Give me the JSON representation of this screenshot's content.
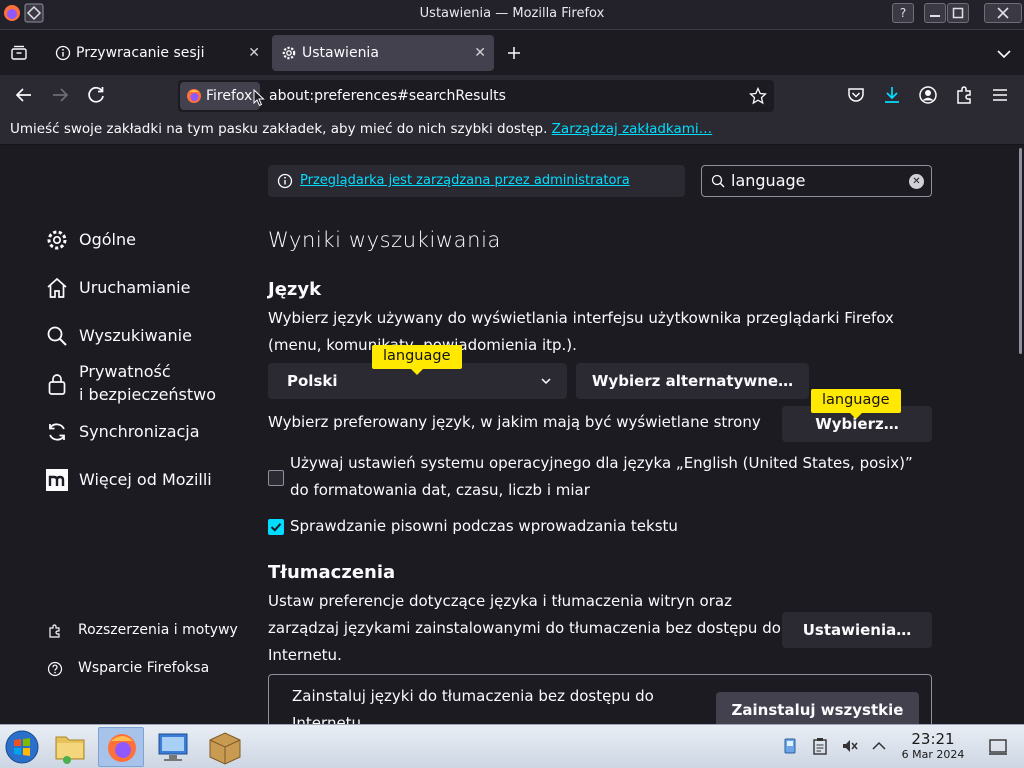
{
  "window": {
    "title": "Ustawienia — Mozilla Firefox",
    "help_button": "?"
  },
  "tabs": [
    {
      "label": "Przywracanie sesji"
    },
    {
      "label": "Ustawienia"
    }
  ],
  "navbar": {
    "identity_label": "Firefox",
    "url": "about:preferences#searchResults"
  },
  "bookmarks_bar": {
    "message": "Umieść swoje zakładki na tym pasku zakładek, aby mieć do nich szybki dostęp.",
    "manage_link": "Zarządzaj zakładkami…"
  },
  "sidebar": {
    "categories": [
      {
        "label": "Ogólne",
        "icon": "gear-icon"
      },
      {
        "label": "Uruchamianie",
        "icon": "home-icon"
      },
      {
        "label": "Wyszukiwanie",
        "icon": "search-icon"
      },
      {
        "label": "Prywatność\ni bezpieczeństwo",
        "icon": "lock-icon"
      },
      {
        "label": "Synchronizacja",
        "icon": "sync-icon"
      },
      {
        "label": "Więcej od Mozilli",
        "icon": "mozilla-icon"
      }
    ],
    "footer": [
      {
        "label": "Rozszerzenia i motywy",
        "icon": "puzzle-icon"
      },
      {
        "label": "Wsparcie Firefoksa",
        "icon": "help-icon"
      }
    ]
  },
  "policy_notice": "Przeglądarka jest zarządzana przez administratora",
  "search": {
    "value": "language"
  },
  "results_heading": "Wyniki wyszukiwania",
  "language_section": {
    "heading": "Język",
    "description": "Wybierz język używany do wyświetlania interfejsu użytkownika przeglądarki Firefox (menu, komunikaty, powiadomienia itp.).",
    "selected_language": "Polski",
    "alternatives_button": "Wybierz alternatywne…",
    "preferred_label": "Wybierz preferowany język, w jakim mają być wyświetlane strony",
    "choose_button": "Wybierz…",
    "tooltip": "language",
    "os_checkbox_label": "Używaj ustawień systemu operacyjnego dla języka „English (United States, posix)” do formatowania dat, czasu, liczb i miar",
    "os_checkbox_checked": false,
    "spellcheck_label": "Sprawdzanie pisowni podczas wprowadzania tekstu",
    "spellcheck_checked": true
  },
  "translations_section": {
    "heading": "Tłumaczenia",
    "description": "Ustaw preferencje dotyczące języka i tłumaczenia witryn oraz zarządzaj językami zainstalowanymi do tłumaczenia bez dostępu do Internetu.",
    "settings_button": "Ustawienia…",
    "install_text": "Zainstaluj języki do tłumaczenia bez dostępu do Internetu",
    "install_all_button": "Zainstaluj wszystkie"
  },
  "taskbar": {
    "time": "23:21",
    "date": "6 Mar 2024"
  },
  "colors": {
    "accent": "#00ddff",
    "tooltip": "#ffe900",
    "background": "#1c1b22",
    "panel": "#2b2a33"
  }
}
